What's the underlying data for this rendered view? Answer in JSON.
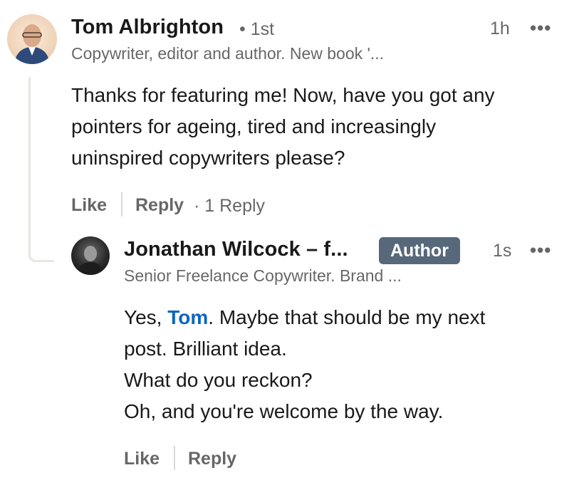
{
  "comment": {
    "author": "Tom Albrighton",
    "connection": "• 1st",
    "headline": "Copywriter, editor and author. New book '...",
    "time": "1h",
    "more": "•••",
    "text_lines": [
      "Thanks for featuring me! Now, have you got any",
      "pointers for ageing, tired and increasingly",
      "uninspired copywriters please?"
    ],
    "like_label": "Like",
    "reply_label": "Reply",
    "reply_count": "· 1 Reply"
  },
  "reply": {
    "author": "Jonathan Wilcock – f...",
    "badge": "Author",
    "headline": "Senior Freelance Copywriter. Brand ...",
    "time": "1s",
    "more": "•••",
    "line1_prefix": "Yes, ",
    "mention": "Tom",
    "line1_suffix": ". Maybe that should be my next",
    "line2": "post. Brilliant idea.",
    "line3": "What do you reckon?",
    "line4": "Oh, and you're welcome by the way.",
    "like_label": "Like",
    "reply_label": "Reply"
  },
  "colors": {
    "mention": "#0a66c2",
    "badge_bg": "#56687a",
    "thread_line": "#e9e5df"
  }
}
